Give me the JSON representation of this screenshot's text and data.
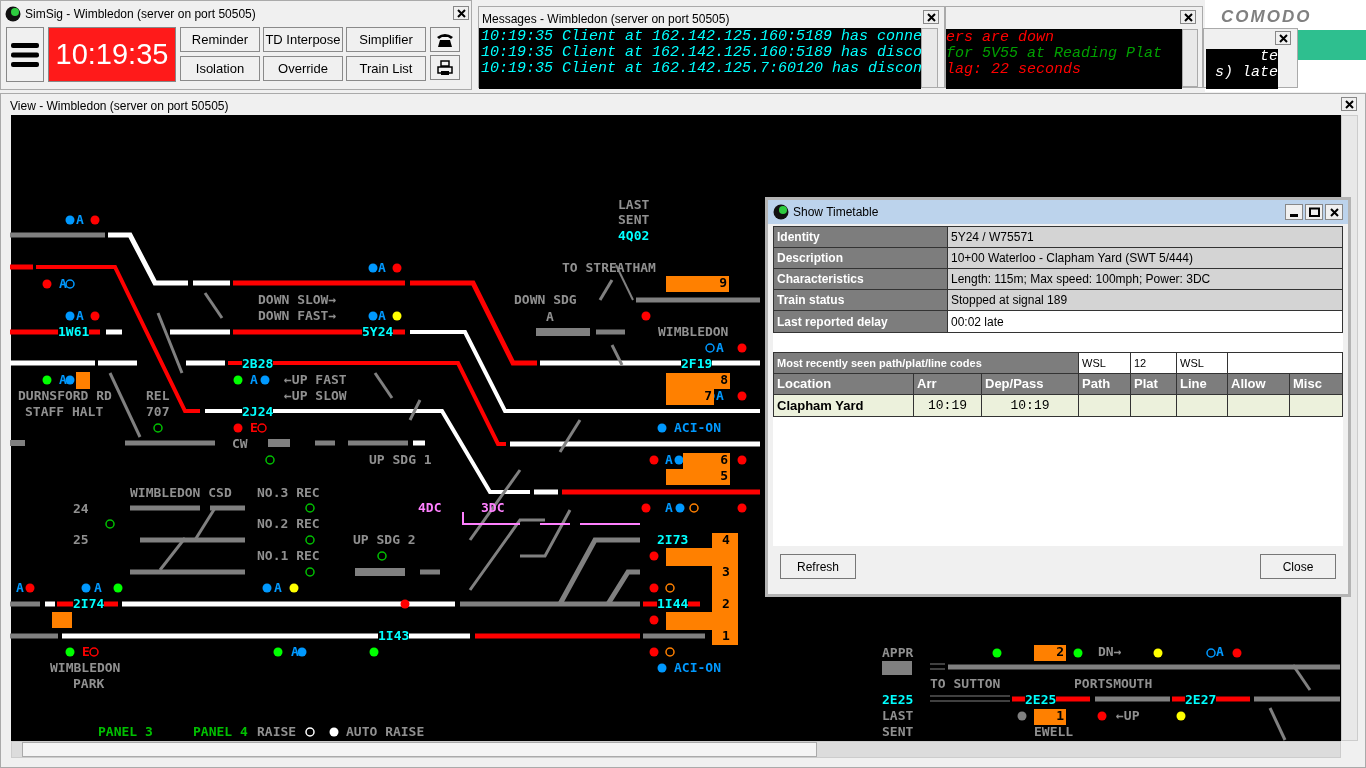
{
  "simsig_window": {
    "title": "SimSig - Wimbledon (server on port 50505)",
    "clock": "10:19:35",
    "buttons": [
      "Reminder",
      "TD Interpose",
      "Simplifier",
      "Isolation",
      "Override",
      "Train List"
    ]
  },
  "messages_window": {
    "title": "Messages - Wimbledon (server on port 50505)",
    "lines": [
      "10:19:35 Client at 162.142.125.160:5189 has conne",
      "10:19:35 Client at 162.142.125.160:5189 has disco",
      "10:19:35 Client at 162.142.125.7:60120 has discon"
    ]
  },
  "background_windows": [
    {
      "lines": [
        {
          "text": "ers are down",
          "kind": "alert"
        },
        {
          "text": "for 5V55 at Reading Plat",
          "kind": "info"
        },
        {
          "text": "lag: 22 seconds",
          "kind": "alert"
        }
      ]
    },
    {
      "lines": [
        {
          "text": "te",
          "kind": "normal"
        },
        {
          "text": "s) late",
          "kind": "normal"
        }
      ]
    }
  ],
  "comodo": {
    "text": "COMODO"
  },
  "view_window": {
    "title": "View - Wimbledon (server on port 50505)",
    "labels": [
      {
        "text": "LAST",
        "kind": "label"
      },
      {
        "text": "SENT",
        "kind": "label"
      },
      {
        "text": "4Q02",
        "kind": "headcode"
      },
      {
        "text": "TO STREATHAM",
        "kind": "label"
      },
      {
        "text": "DOWN SLOW→",
        "kind": "label"
      },
      {
        "text": "DOWN FAST→",
        "kind": "label"
      },
      {
        "text": "DOWN SDG",
        "kind": "label"
      },
      {
        "text": "A",
        "kind": "label"
      },
      {
        "text": "WIMBLEDON",
        "kind": "label"
      },
      {
        "text": "←UP FAST",
        "kind": "label"
      },
      {
        "text": "DURNSFORD RD",
        "kind": "label"
      },
      {
        "text": "REL",
        "kind": "label"
      },
      {
        "text": "←UP SLOW",
        "kind": "label"
      },
      {
        "text": "STAFF HALT",
        "kind": "label"
      },
      {
        "text": "707",
        "kind": "label"
      },
      {
        "text": "CW",
        "kind": "label"
      },
      {
        "text": "UP SDG 1",
        "kind": "label"
      },
      {
        "text": "WIMBLEDON CSD",
        "kind": "label"
      },
      {
        "text": "NO.3 REC",
        "kind": "label"
      },
      {
        "text": "NO.2 REC",
        "kind": "label"
      },
      {
        "text": "NO.1 REC",
        "kind": "label"
      },
      {
        "text": "24",
        "kind": "label"
      },
      {
        "text": "25",
        "kind": "label"
      },
      {
        "text": "UP SDG 2",
        "kind": "label"
      },
      {
        "text": "WIMBLEDON",
        "kind": "label"
      },
      {
        "text": "PARK",
        "kind": "label"
      },
      {
        "text": "APPR",
        "kind": "label"
      },
      {
        "text": "DN→",
        "kind": "label"
      },
      {
        "text": "TO SUTTON",
        "kind": "label"
      },
      {
        "text": "PORTSMOUTH",
        "kind": "label"
      },
      {
        "text": "2E25",
        "kind": "headcode"
      },
      {
        "text": "LAST",
        "kind": "label"
      },
      {
        "text": "SENT",
        "kind": "label"
      },
      {
        "text": "←UP",
        "kind": "label"
      },
      {
        "text": "EWELL",
        "kind": "label"
      },
      {
        "text": "1W61",
        "kind": "headcode"
      },
      {
        "text": "5Y24",
        "kind": "headcode"
      },
      {
        "text": "2B28",
        "kind": "headcode"
      },
      {
        "text": "2J24",
        "kind": "headcode"
      },
      {
        "text": "2F19",
        "kind": "headcode"
      },
      {
        "text": "2I74",
        "kind": "headcode"
      },
      {
        "text": "1I43",
        "kind": "headcode"
      },
      {
        "text": "2I73",
        "kind": "headcode"
      },
      {
        "text": "1I44",
        "kind": "headcode"
      },
      {
        "text": "2E25",
        "kind": "headcode"
      },
      {
        "text": "2E27",
        "kind": "headcode"
      },
      {
        "text": "9",
        "kind": "berth"
      },
      {
        "text": "8",
        "kind": "berth"
      },
      {
        "text": "7",
        "kind": "berth"
      },
      {
        "text": "6",
        "kind": "berth"
      },
      {
        "text": "5",
        "kind": "berth"
      },
      {
        "text": "2",
        "kind": "berth"
      },
      {
        "text": "1",
        "kind": "berth"
      },
      {
        "text": "4",
        "kind": "platform"
      },
      {
        "text": "3",
        "kind": "platform"
      },
      {
        "text": "2",
        "kind": "platform"
      },
      {
        "text": "1",
        "kind": "platform"
      },
      {
        "text": "ACI-ON",
        "kind": "aci"
      },
      {
        "text": "ACI-ON",
        "kind": "aci"
      },
      {
        "text": "4DC",
        "kind": "power"
      },
      {
        "text": "3DC",
        "kind": "power"
      },
      {
        "text": "PANEL 3",
        "kind": "panel"
      },
      {
        "text": "PANEL 4",
        "kind": "panel"
      },
      {
        "text": "RAISE",
        "kind": "label"
      },
      {
        "text": "AUTO RAISE",
        "kind": "label"
      },
      {
        "text": "E",
        "kind": "warning"
      },
      {
        "text": "E",
        "kind": "warning"
      },
      {
        "text": "A",
        "kind": "auto"
      },
      {
        "text": "A",
        "kind": "auto"
      },
      {
        "text": "A",
        "kind": "auto"
      },
      {
        "text": "A",
        "kind": "auto"
      },
      {
        "text": "A",
        "kind": "auto"
      },
      {
        "text": "A",
        "kind": "auto"
      },
      {
        "text": "A",
        "kind": "auto"
      },
      {
        "text": "A",
        "kind": "auto"
      },
      {
        "text": "A",
        "kind": "auto"
      },
      {
        "text": "A",
        "kind": "auto"
      },
      {
        "text": "A",
        "kind": "auto"
      },
      {
        "text": "A",
        "kind": "auto"
      },
      {
        "text": "A",
        "kind": "auto"
      },
      {
        "text": "A",
        "kind": "auto"
      },
      {
        "text": "A",
        "kind": "auto"
      },
      {
        "text": "A",
        "kind": "auto"
      }
    ]
  },
  "timetable": {
    "title": "Show Timetable",
    "details": [
      {
        "label": "Identity",
        "value": "5Y24 / W75571"
      },
      {
        "label": "Description",
        "value": "10+00 Waterloo - Clapham Yard (SWT 5/444)"
      },
      {
        "label": "Characteristics",
        "value": "Length: 115m; Max speed: 100mph; Power: 3DC"
      },
      {
        "label": "Train status",
        "value": "Stopped at signal 189"
      },
      {
        "label": "Last reported delay",
        "value": "00:02 late"
      }
    ],
    "codes": {
      "label": "Most recently seen path/plat/line codes",
      "values": [
        "WSL",
        "12",
        "WSL"
      ]
    },
    "columns": [
      "Location",
      "Arr",
      "Dep/Pass",
      "Path",
      "Plat",
      "Line",
      "Allow",
      "Misc"
    ],
    "rows": [
      {
        "location": "Clapham Yard",
        "arr": "10:19",
        "dep": "10:19"
      }
    ],
    "buttons": [
      "Refresh",
      "Close"
    ]
  }
}
